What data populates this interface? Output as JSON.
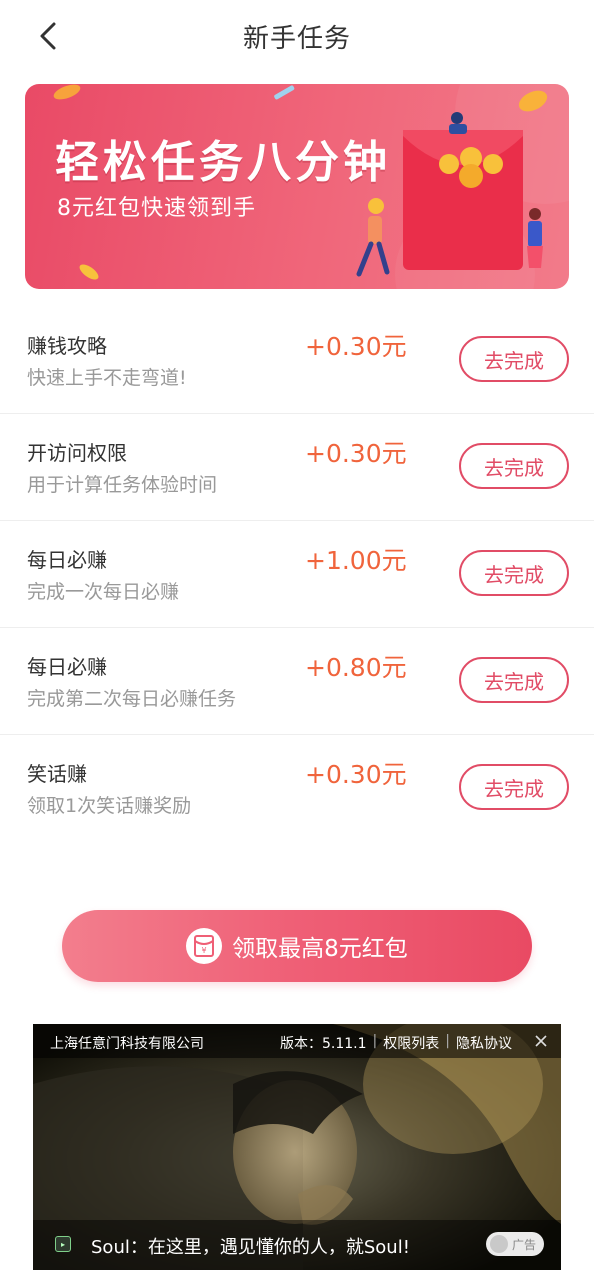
{
  "header": {
    "title": "新手任务",
    "back_icon": "chevron-left-icon"
  },
  "banner": {
    "title": "轻松任务八分钟",
    "subtitle": "8元红包快速领到手",
    "colors": {
      "start": "#e94a66",
      "end": "#f27b8a"
    }
  },
  "tasks": [
    {
      "name": "赚钱攻略",
      "desc": "快速上手不走弯道!",
      "reward": "+0.30元",
      "button": "去完成"
    },
    {
      "name": "开访问权限",
      "desc": "用于计算任务体验时间",
      "reward": "+0.30元",
      "button": "去完成"
    },
    {
      "name": "每日必赚",
      "desc": "完成一次每日必赚",
      "reward": "+1.00元",
      "button": "去完成"
    },
    {
      "name": "每日必赚",
      "desc": "完成第二次每日必赚任务",
      "reward": "+0.80元",
      "button": "去完成"
    },
    {
      "name": "笑话赚",
      "desc": "领取1次笑话赚奖励",
      "reward": "+0.30元",
      "button": "去完成"
    }
  ],
  "claim": {
    "label": "领取最高8元红包",
    "icon": "red-envelope-icon"
  },
  "ad": {
    "company": "上海任意门科技有限公司",
    "version": "版本：5.11.1",
    "permissions": "权限列表",
    "privacy": "隐私协议",
    "slogan": "Soul：在这里，遇见懂你的人，就Soul!",
    "badge": "广告"
  },
  "colors": {
    "accent": "#e14c66",
    "reward": "#f0643c",
    "muted_text": "#999999"
  }
}
